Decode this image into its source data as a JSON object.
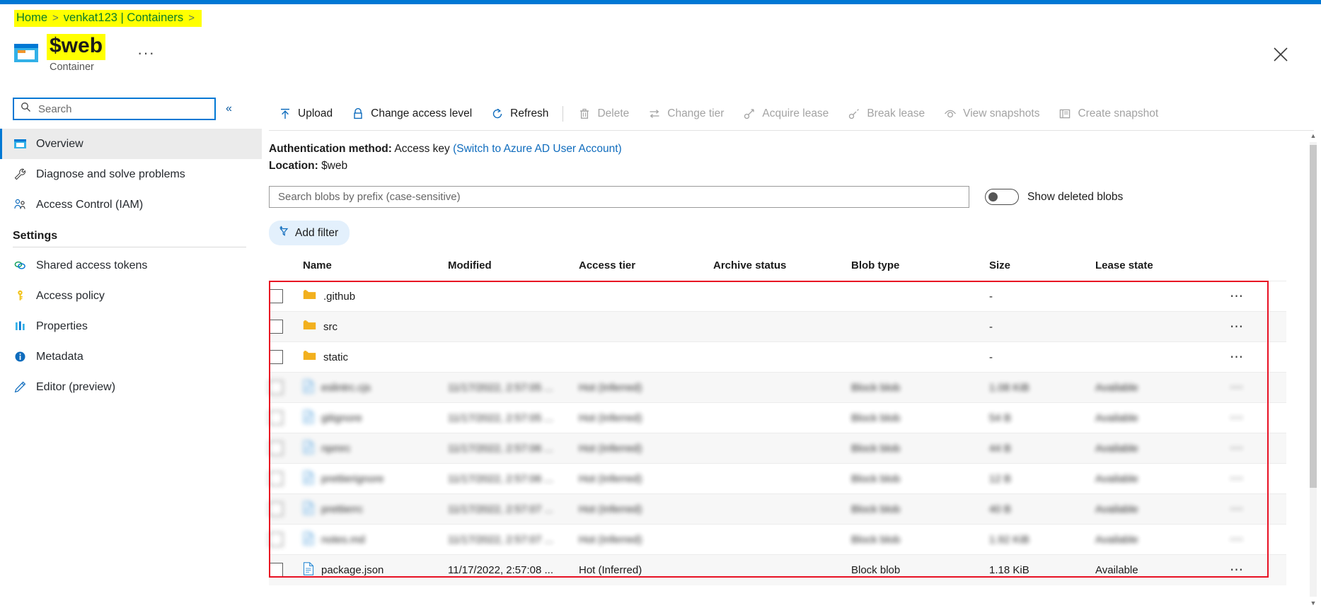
{
  "breadcrumb": {
    "items": [
      {
        "label": "Home",
        "icon": "none"
      },
      {
        "label": "venkat123 | Containers",
        "icon": "none"
      }
    ],
    "separator": ">"
  },
  "header": {
    "title": "$web",
    "subtitle": "Container",
    "more_label": "···",
    "icon": "container-icon",
    "close_icon": "close-icon",
    "highlight_color": "#ffff00",
    "accent_color": "#0078d4"
  },
  "sidebar": {
    "search": {
      "placeholder": "Search",
      "value": "",
      "icon": "search-icon"
    },
    "collapse_icon": "chevron-double-left-icon",
    "items": [
      {
        "label": "Overview",
        "icon": "overview-icon",
        "active": true
      },
      {
        "label": "Diagnose and solve problems",
        "icon": "wrench-icon",
        "active": false
      },
      {
        "label": "Access Control (IAM)",
        "icon": "people-icon",
        "active": false
      }
    ],
    "section_title": "Settings",
    "settings_items": [
      {
        "label": "Shared access tokens",
        "icon": "link-rings-icon"
      },
      {
        "label": "Access policy",
        "icon": "key-icon"
      },
      {
        "label": "Properties",
        "icon": "bars-icon"
      },
      {
        "label": "Metadata",
        "icon": "info-icon"
      },
      {
        "label": "Editor (preview)",
        "icon": "pencil-icon"
      }
    ]
  },
  "toolbar": {
    "commands": [
      {
        "label": "Upload",
        "icon": "upload-icon",
        "disabled": false,
        "sep_after": false
      },
      {
        "label": "Change access level",
        "icon": "lock-icon",
        "disabled": false,
        "sep_after": false
      },
      {
        "label": "Refresh",
        "icon": "refresh-icon",
        "disabled": false,
        "sep_after": true
      },
      {
        "label": "Delete",
        "icon": "trash-icon",
        "disabled": true,
        "sep_after": false
      },
      {
        "label": "Change tier",
        "icon": "swap-icon",
        "disabled": true,
        "sep_after": false
      },
      {
        "label": "Acquire lease",
        "icon": "lease-icon",
        "disabled": true,
        "sep_after": false
      },
      {
        "label": "Break lease",
        "icon": "break-lease-icon",
        "disabled": true,
        "sep_after": false
      },
      {
        "label": "View snapshots",
        "icon": "snapshot-view-icon",
        "disabled": true,
        "sep_after": false
      },
      {
        "label": "Create snapshot",
        "icon": "snapshot-create-icon",
        "disabled": true,
        "sep_after": false
      }
    ]
  },
  "info": {
    "auth_label": "Authentication method:",
    "auth_value": "Access key",
    "auth_switch_link": "(Switch to Azure AD User Account)",
    "location_label": "Location:",
    "location_value": "$web"
  },
  "filters": {
    "blob_search_placeholder": "Search blobs by prefix (case-sensitive)",
    "blob_search_value": "",
    "show_deleted_label": "Show deleted blobs",
    "show_deleted_on": false,
    "add_filter_label": "Add filter",
    "add_filter_icon": "filter-plus-icon"
  },
  "table": {
    "columns": [
      "Name",
      "Modified",
      "Access tier",
      "Archive status",
      "Blob type",
      "Size",
      "Lease state"
    ],
    "more_icon": "ellipsis-icon",
    "rows": [
      {
        "name": ".github",
        "icon": "folder-icon",
        "modified": "",
        "access_tier": "",
        "archive_status": "",
        "blob_type": "",
        "size": "-",
        "lease_state": "",
        "blurred": false
      },
      {
        "name": "src",
        "icon": "folder-icon",
        "modified": "",
        "access_tier": "",
        "archive_status": "",
        "blob_type": "",
        "size": "-",
        "lease_state": "",
        "blurred": false
      },
      {
        "name": "static",
        "icon": "folder-icon",
        "modified": "",
        "access_tier": "",
        "archive_status": "",
        "blob_type": "",
        "size": "-",
        "lease_state": "",
        "blurred": false
      },
      {
        "name": "eslintrc.cjs",
        "icon": "file-icon",
        "modified": "11/17/2022, 2:57:05 ...",
        "access_tier": "Hot (Inferred)",
        "archive_status": "",
        "blob_type": "Block blob",
        "size": "1.08 KiB",
        "lease_state": "Available",
        "blurred": true
      },
      {
        "name": "gitignore",
        "icon": "file-icon",
        "modified": "11/17/2022, 2:57:05 ...",
        "access_tier": "Hot (Inferred)",
        "archive_status": "",
        "blob_type": "Block blob",
        "size": "54 B",
        "lease_state": "Available",
        "blurred": true
      },
      {
        "name": "npmrc",
        "icon": "file-icon",
        "modified": "11/17/2022, 2:57:06 ...",
        "access_tier": "Hot (Inferred)",
        "archive_status": "",
        "blob_type": "Block blob",
        "size": "44 B",
        "lease_state": "Available",
        "blurred": true
      },
      {
        "name": "prettierignore",
        "icon": "file-icon",
        "modified": "11/17/2022, 2:57:06 ...",
        "access_tier": "Hot (Inferred)",
        "archive_status": "",
        "blob_type": "Block blob",
        "size": "12 B",
        "lease_state": "Available",
        "blurred": true
      },
      {
        "name": "prettierrc",
        "icon": "file-icon",
        "modified": "11/17/2022, 2:57:07 ...",
        "access_tier": "Hot (Inferred)",
        "archive_status": "",
        "blob_type": "Block blob",
        "size": "40 B",
        "lease_state": "Available",
        "blurred": true
      },
      {
        "name": "notes.md",
        "icon": "file-icon",
        "modified": "11/17/2022, 2:57:07 ...",
        "access_tier": "Hot (Inferred)",
        "archive_status": "",
        "blob_type": "Block blob",
        "size": "1.92 KiB",
        "lease_state": "Available",
        "blurred": true
      },
      {
        "name": "package.json",
        "icon": "file-icon",
        "modified": "11/17/2022, 2:57:08 ...",
        "access_tier": "Hot (Inferred)",
        "archive_status": "",
        "blob_type": "Block blob",
        "size": "1.18 KiB",
        "lease_state": "Available",
        "blurred": false
      }
    ]
  },
  "annotations": {
    "highlight_color": "#ffff00",
    "redbox_color": "#e81123"
  }
}
